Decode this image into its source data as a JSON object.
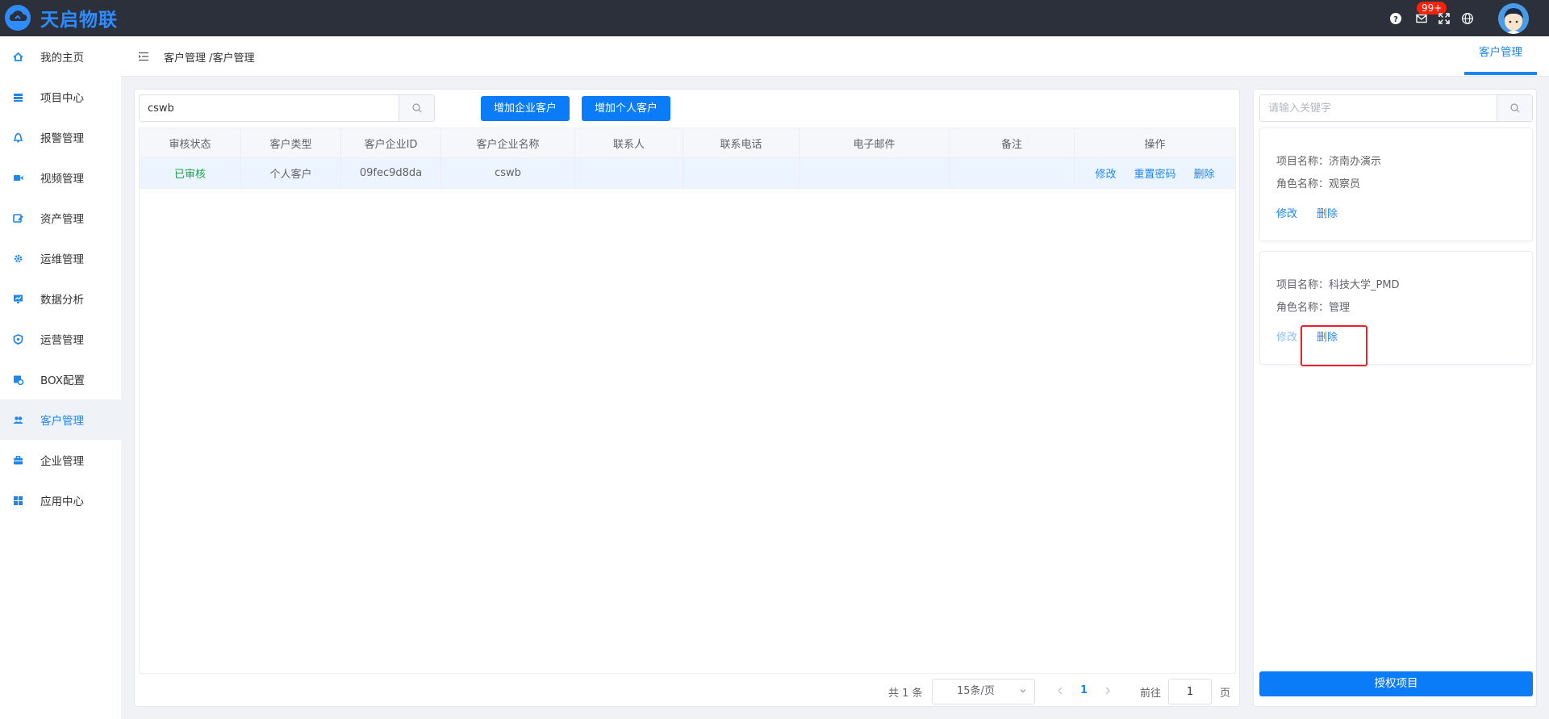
{
  "app": {
    "logo_text": "天启物联"
  },
  "topbar": {
    "icons": [
      "help-icon",
      "mail-icon",
      "fullscreen-icon",
      "globe-icon"
    ],
    "mail_badge": "99+"
  },
  "sidebar": {
    "items": [
      {
        "label": "我的主页",
        "icon": "home-icon"
      },
      {
        "label": "项目中心",
        "icon": "layers-icon"
      },
      {
        "label": "报警管理",
        "icon": "bell-icon"
      },
      {
        "label": "视频管理",
        "icon": "video-icon"
      },
      {
        "label": "资产管理",
        "icon": "asset-icon"
      },
      {
        "label": "运维管理",
        "icon": "gear-icon"
      },
      {
        "label": "数据分析",
        "icon": "monitor-chart-icon"
      },
      {
        "label": "运营管理",
        "icon": "shield-icon"
      },
      {
        "label": "BOX配置",
        "icon": "box-config-icon"
      },
      {
        "label": "客户管理",
        "icon": "users-icon",
        "active": true
      },
      {
        "label": "企业管理",
        "icon": "briefcase-icon"
      },
      {
        "label": "应用中心",
        "icon": "grid-icon"
      }
    ]
  },
  "header": {
    "breadcrumb": "客户管理 /客户管理",
    "tab": "客户管理"
  },
  "main": {
    "search_value": "cswb",
    "add_enterprise_label": "增加企业客户",
    "add_personal_label": "增加个人客户",
    "columns": [
      "审核状态",
      "客户类型",
      "客户企业ID",
      "客户企业名称",
      "联系人",
      "联系电话",
      "电子邮件",
      "备注",
      "操作"
    ],
    "rows": [
      {
        "status": "已审核",
        "type": "个人客户",
        "id": "09fec9d8da",
        "name": "cswb",
        "contact": "",
        "phone": "",
        "email": "",
        "remark": "",
        "actions": [
          "修改",
          "重置密码",
          "删除"
        ]
      }
    ],
    "pagination": {
      "total": "共 1 条",
      "page_size": "15条/页",
      "current_page": "1",
      "goto_label": "前往",
      "goto_value": "1",
      "page_unit": "页"
    }
  },
  "right_panel": {
    "search_placeholder": "请输入关键字",
    "cards": [
      {
        "project_line": "项目名称：济南办演示",
        "role_line": "角色名称：观察员",
        "edit": "修改",
        "delete": "删除"
      },
      {
        "project_line": "项目名称：科技大学_PMD",
        "role_line": "角色名称：管理",
        "edit": "修改",
        "delete": "删除"
      }
    ],
    "authorize_button": "授权项目"
  },
  "colors": {
    "topbar_bg": "#2b303b",
    "accent": "#1c86f2",
    "primary_button": "#0a7cf8",
    "approved_status": "#1aa34a",
    "highlight_border": "#e8232a"
  }
}
